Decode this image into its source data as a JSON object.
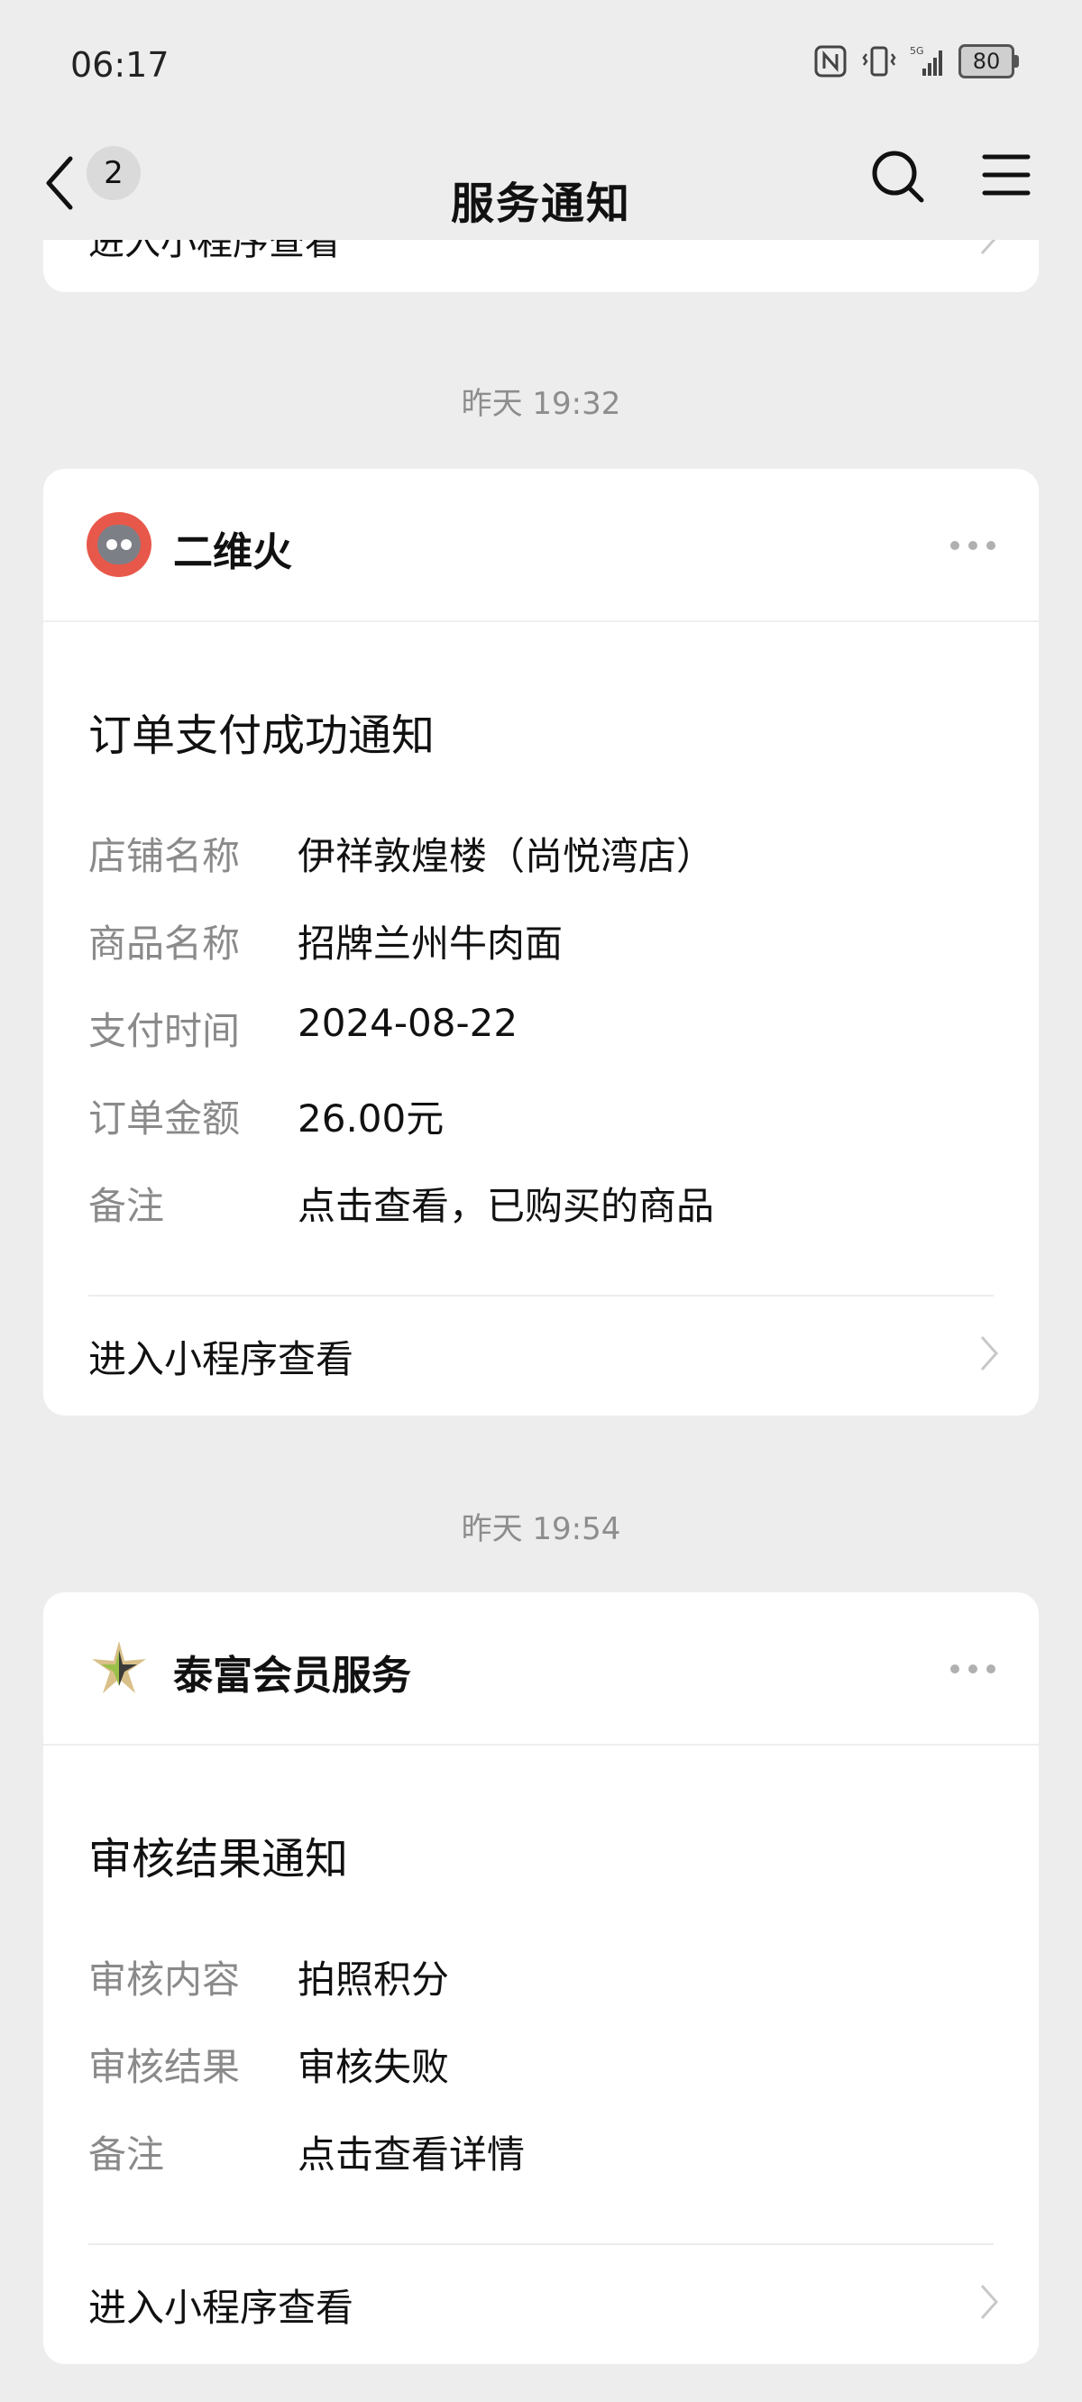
{
  "status_bar": {
    "time": "06:17",
    "battery": "80",
    "icons": [
      "nfc-icon",
      "vibrate-icon",
      "signal-5g-icon",
      "battery-icon"
    ]
  },
  "nav": {
    "back_count": "2",
    "title": "服务通知"
  },
  "top_card": {
    "link_label": "进入小程序查看"
  },
  "messages": [
    {
      "timestamp": "昨天 19:32",
      "sender": "二维火",
      "title": "订单支付成功通知",
      "fields": [
        {
          "key": "店铺名称",
          "value": "伊祥敦煌楼（尚悦湾店）"
        },
        {
          "key": "商品名称",
          "value": "招牌兰州牛肉面"
        },
        {
          "key": "支付时间",
          "value": "2024-08-22"
        },
        {
          "key": "订单金额",
          "value": "26.00元"
        },
        {
          "key": "备注",
          "value": "点击查看，已购买的商品"
        }
      ],
      "link_label": "进入小程序查看"
    },
    {
      "timestamp": "昨天 19:54",
      "sender": "泰富会员服务",
      "title": "审核结果通知",
      "fields": [
        {
          "key": "审核内容",
          "value": "拍照积分"
        },
        {
          "key": "审核结果",
          "value": "审核失败"
        },
        {
          "key": "备注",
          "value": "点击查看详情"
        }
      ],
      "link_label": "进入小程序查看"
    }
  ]
}
